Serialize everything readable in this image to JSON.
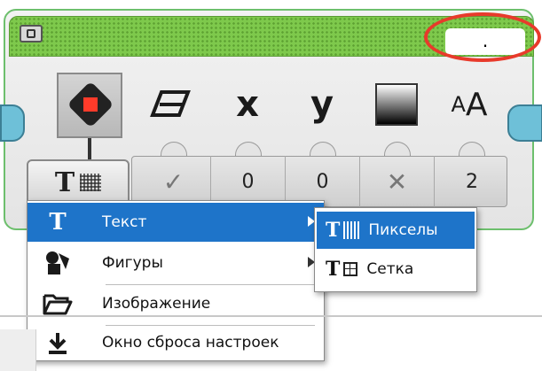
{
  "block": {
    "header_value": ".",
    "param_values": [
      "✓",
      "0",
      "0",
      "✕",
      "2"
    ]
  },
  "menu": {
    "items": [
      {
        "label": "Текст",
        "icon": "text-t-icon",
        "has_submenu": true,
        "active": true
      },
      {
        "label": "Фигуры",
        "icon": "shapes-icon",
        "has_submenu": true,
        "active": false
      },
      {
        "label": "Изображение",
        "icon": "folder-open-icon",
        "has_submenu": false,
        "active": false
      },
      {
        "label": "Окно сброса настроек",
        "icon": "reset-download-icon",
        "has_submenu": false,
        "active": false
      }
    ]
  },
  "submenu": {
    "items": [
      {
        "label": "Пикселы",
        "icon": "text-pixels-icon",
        "active": true
      },
      {
        "label": "Сетка",
        "icon": "text-grid-icon",
        "active": false
      }
    ]
  },
  "colors": {
    "header_green": "#7ec94c",
    "highlight_red": "#e83a2b",
    "menu_active_blue": "#1e74c9",
    "connector_blue": "#6ec0d8"
  }
}
